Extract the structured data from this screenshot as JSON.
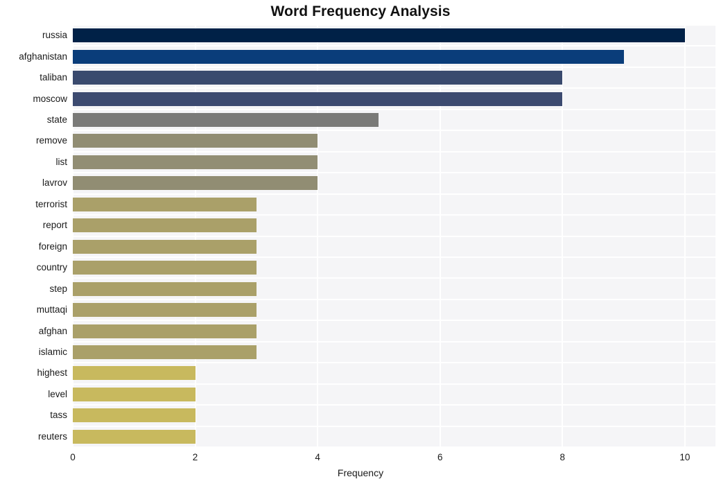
{
  "chart_data": {
    "type": "bar",
    "orientation": "horizontal",
    "title": "Word Frequency Analysis",
    "xlabel": "Frequency",
    "ylabel": "",
    "xlim": [
      0,
      10.5
    ],
    "xticks": [
      0,
      2,
      4,
      6,
      8,
      10
    ],
    "xtick_labels": [
      "0",
      "2",
      "4",
      "6",
      "8",
      "10"
    ],
    "grid": true,
    "legend": null,
    "categories": [
      "russia",
      "afghanistan",
      "taliban",
      "moscow",
      "state",
      "remove",
      "list",
      "lavrov",
      "terrorist",
      "report",
      "foreign",
      "country",
      "step",
      "muttaqi",
      "afghan",
      "islamic",
      "highest",
      "level",
      "tass",
      "reuters"
    ],
    "values": [
      10,
      9,
      8,
      8,
      5,
      4,
      4,
      4,
      3,
      3,
      3,
      3,
      3,
      3,
      3,
      3,
      2,
      2,
      2,
      2
    ],
    "bar_colors": [
      "#002147",
      "#0a3d7a",
      "#3a4a6e",
      "#3c4a70",
      "#7a7a78",
      "#918d73",
      "#928e74",
      "#918d73",
      "#aaa069",
      "#aaa069",
      "#aaa069",
      "#aaa069",
      "#aaa069",
      "#aaa069",
      "#aaa069",
      "#aaa069",
      "#c8b95e",
      "#c8b95e",
      "#c8b95e",
      "#c8b95e"
    ],
    "plot_background": "#f5f5f7",
    "gridline_color": "#ffffff",
    "figure_background": "#ffffff",
    "text_color": "#1a1a1a"
  }
}
